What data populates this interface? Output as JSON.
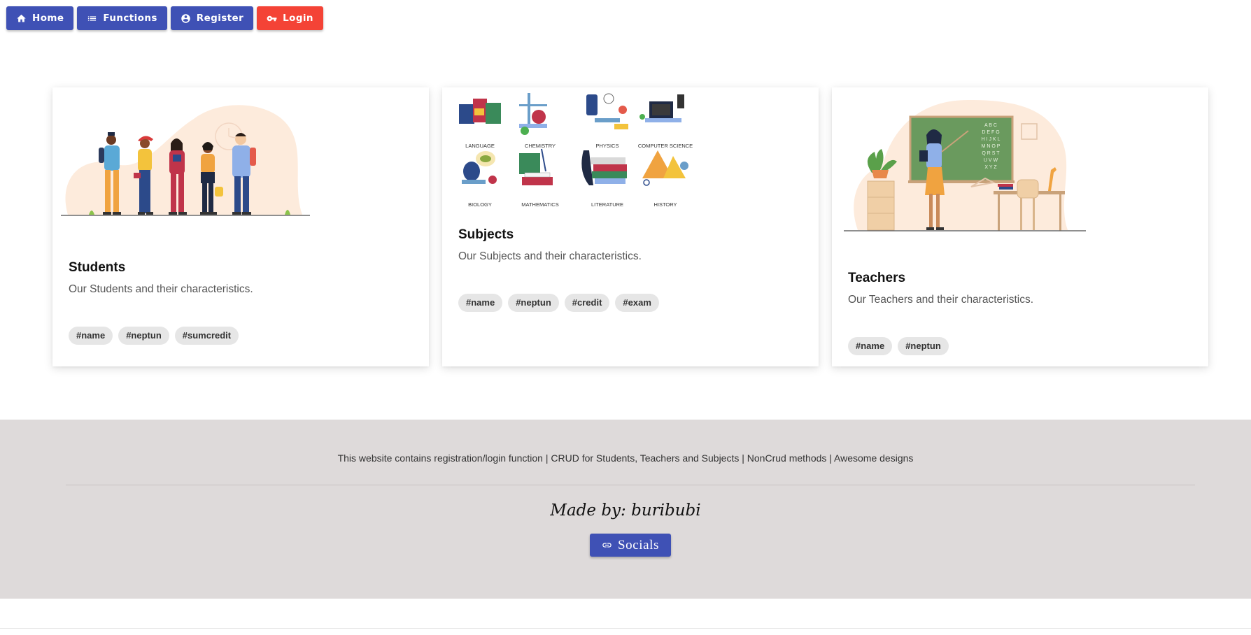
{
  "nav": {
    "items": [
      {
        "label": "Home",
        "icon": "home-icon"
      },
      {
        "label": "Functions",
        "icon": "list-icon"
      },
      {
        "label": "Register",
        "icon": "account-circle-icon"
      },
      {
        "label": "Login",
        "icon": "key-icon"
      }
    ]
  },
  "cards": {
    "students": {
      "title": "Students",
      "text": "Our Students and their characteristics.",
      "tags": [
        "#name",
        "#neptun",
        "#sumcredit"
      ]
    },
    "subjects": {
      "title": "Subjects",
      "text": "Our Subjects and their characteristics.",
      "tags": [
        "#name",
        "#neptun",
        "#credit",
        "#exam"
      ],
      "illustration_labels": [
        "LANGUAGE",
        "CHEMISTRY",
        "PHYSICS",
        "COMPUTER SCIENCE",
        "BIOLOGY",
        "MATHEMATICS",
        "LITERATURE",
        "HISTORY"
      ]
    },
    "teachers": {
      "title": "Teachers",
      "text": "Our Teachers and their characteristics.",
      "tags": [
        "#name",
        "#neptun"
      ],
      "board_letters": [
        "A B C",
        "D E F G",
        "H I J K L",
        "M N O P",
        "Q R S T",
        "U V W",
        "X Y Z"
      ]
    }
  },
  "footer": {
    "description": "This website contains registration/login function | CRUD for Students, Teachers and Subjects | NonCrud methods | Awesome designs",
    "made_by": "Made by: buribubi",
    "socials_label": "Socials",
    "socials_icon": "link-icon"
  },
  "colors": {
    "primary": "#3f51b5",
    "danger": "#f44336",
    "footer_bg": "#dedada",
    "chip_bg": "#e6e6e6"
  }
}
